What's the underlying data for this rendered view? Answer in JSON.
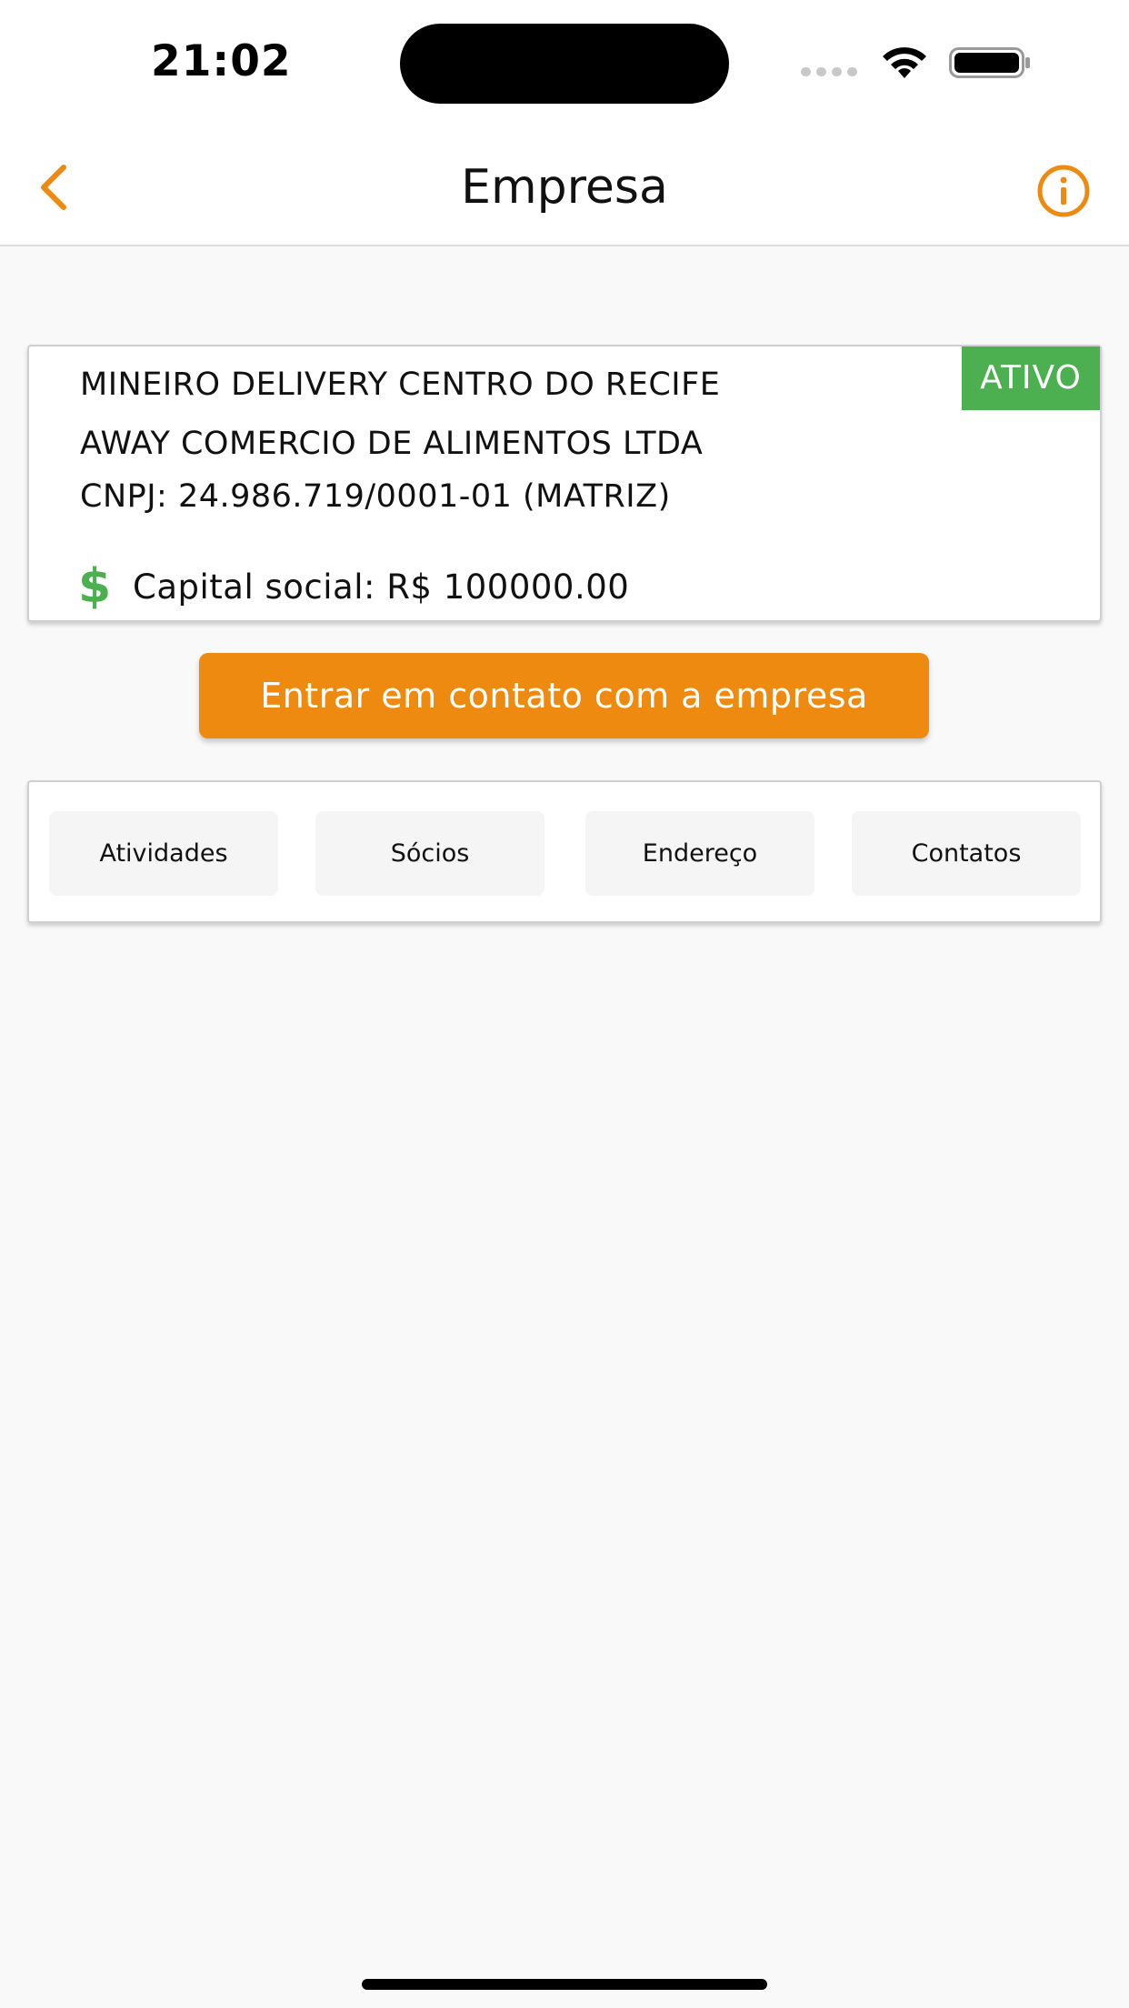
{
  "status_bar": {
    "time": "21:02"
  },
  "nav": {
    "title": "Empresa"
  },
  "company": {
    "name_line1": "MINEIRO DELIVERY CENTRO DO RECIFE",
    "name_line2": "AWAY COMERCIO DE ALIMENTOS LTDA",
    "cnpj_line": "CNPJ: 24.986.719/0001-01 (MATRIZ)",
    "status": "ATIVO",
    "capital_text": "Capital social: R$ 100000.00"
  },
  "contact_button_label": "Entrar em contato com a empresa",
  "tabs": [
    {
      "label": "Atividades"
    },
    {
      "label": "Sócios"
    },
    {
      "label": "Endereço"
    },
    {
      "label": "Contatos"
    }
  ],
  "colors": {
    "accent": "#ee8a10",
    "status_active": "#4caf50",
    "background": "#f9f9f9"
  },
  "icons": {
    "back": "chevron-left-icon",
    "info": "info-circle-icon",
    "capital": "dollar-icon"
  }
}
